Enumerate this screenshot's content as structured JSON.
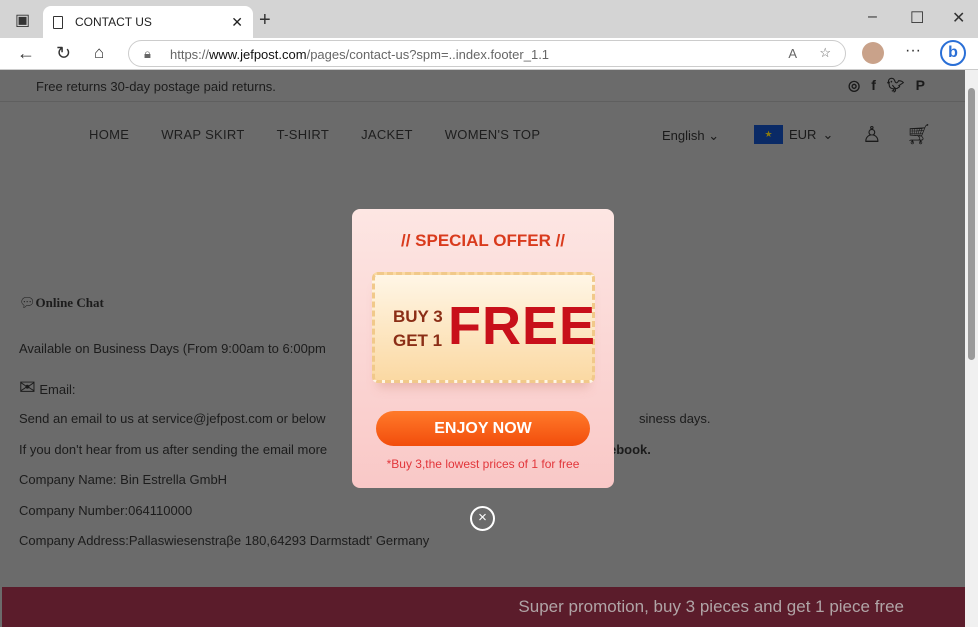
{
  "browser": {
    "tab_title": "CONTACT US",
    "url_prefix": "https://",
    "url_domain": "www.jefpost.com",
    "url_path": "/pages/contact-us?spm=..index.footer_1.1"
  },
  "site": {
    "announcement": "Free returns 30-day postage paid returns.",
    "social": [
      "instagram-icon",
      "facebook-icon",
      "twitter-icon",
      "pinterest-icon"
    ],
    "nav": [
      "HOME",
      "WRAP SKIRT",
      "T-SHIRT",
      "JACKET",
      "WOMEN'S TOP"
    ],
    "language": "English",
    "currency": "EUR",
    "online_chat": "Online Chat",
    "availability": "Available on Business Days  (From 9:00am to 6:00pm",
    "email_label": "Email:",
    "email_line_a": "Send an email to us at service@jefpost.com or below",
    "email_line_b": "siness days.",
    "followup_a": "If you don't hear from us after sending the email more",
    "followup_b": "ebook.",
    "company_name": "Company Name: Bin Estrella GmbH",
    "company_number": "Company Number:064110000",
    "company_address": "Company Address:Pallaswiesenstraβe 180,64293 Darmstadt' Germany",
    "promo_bar": "Super promotion, buy 3 pieces and get 1 piece free"
  },
  "popup": {
    "title": "// SPECIAL OFFER //",
    "buy": "BUY 3",
    "get": "GET 1",
    "free": "FREE",
    "button": "ENJOY NOW",
    "note": "*Buy 3,the lowest prices of 1 for free",
    "close": "×"
  }
}
